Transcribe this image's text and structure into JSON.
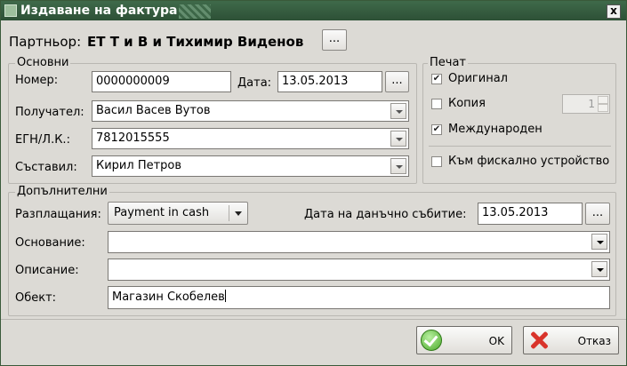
{
  "window": {
    "title": "Издаване на фактура",
    "close_glyph": "x"
  },
  "partner": {
    "label": "Партньор:",
    "name": "ЕТ Т и В и Тихимир Виденов",
    "browse_label": "..."
  },
  "basic": {
    "group_label": "Основни",
    "number_label": "Номер:",
    "number_value": "0000000009",
    "date_label": "Дата:",
    "date_value": "13.05.2013",
    "date_button": "...",
    "recipient_label": "Получател:",
    "recipient_value": "Васил Васев Вутов",
    "egn_label": "ЕГН/Л.К.:",
    "egn_value": "7812015555",
    "author_label": "Съставил:",
    "author_value": "Кирил Петров"
  },
  "print": {
    "group_label": "Печат",
    "original_label": "Оригинал",
    "original_checked": true,
    "copy_label": "Копия",
    "copy_checked": false,
    "copies_value": "1",
    "international_label": "Международен",
    "international_checked": true,
    "fiscal_label": "Към фискално устройство",
    "fiscal_checked": false
  },
  "additional": {
    "group_label": "Допълнителни",
    "payment_label": "Разплащания:",
    "payment_value": "Payment in cash",
    "tax_date_label": "Дата на данъчно събитие:",
    "tax_date_value": "13.05.2013",
    "tax_date_button": "...",
    "basis_label": "Основание:",
    "basis_value": "",
    "description_label": "Описание:",
    "description_value": "",
    "object_label": "Обект:",
    "object_value": "Магазин Скобелев"
  },
  "buttons": {
    "ok_label": "OK",
    "cancel_label": "Отказ"
  },
  "icons": {
    "check_glyph": "✔",
    "window_icon": "window-icon",
    "ok_icon": "ok-check-icon",
    "cancel_icon": "cancel-x-icon"
  }
}
